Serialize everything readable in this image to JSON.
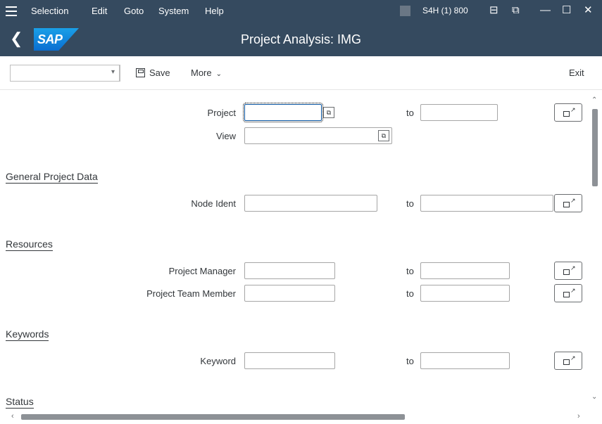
{
  "menubar": {
    "items": [
      "Selection",
      "Edit",
      "Goto",
      "System",
      "Help"
    ],
    "system_info": "S4H (1) 800",
    "icons": [
      "menu-icon",
      "system-status-icon",
      "layout-icon",
      "new-window-icon",
      "minimize-icon",
      "maximize-icon",
      "close-icon"
    ],
    "controls": {
      "layout": "⊟",
      "newwin": "⧉",
      "min": "—",
      "max": "☐",
      "close": "✕"
    }
  },
  "titlebar": {
    "logo_text": "SAP",
    "title": "Project Analysis: IMG",
    "back_glyph": "❮"
  },
  "toolbar": {
    "command_field_value": "",
    "save_label": "Save",
    "more_label": "More",
    "exit_label": "Exit"
  },
  "selection": {
    "to_label": "to",
    "project": {
      "label": "Project",
      "value_from": "",
      "value_to": ""
    },
    "view": {
      "label": "View",
      "value": ""
    }
  },
  "sections": {
    "general": {
      "title": "General Project Data",
      "fields": [
        {
          "label": "Node Ident",
          "value_from": "",
          "value_to": ""
        }
      ]
    },
    "resources": {
      "title": "Resources",
      "fields": [
        {
          "label": "Project Manager",
          "value_from": "",
          "value_to": ""
        },
        {
          "label": "Project Team Member",
          "value_from": "",
          "value_to": ""
        }
      ]
    },
    "keywords": {
      "title": "Keywords",
      "fields": [
        {
          "label": "Keyword",
          "value_from": "",
          "value_to": ""
        }
      ]
    },
    "status": {
      "title": "Status"
    }
  },
  "colors": {
    "shell": "#354a5f",
    "brand": "#0a6ed1",
    "text": "#32363a",
    "field_border": "#a6a6a6"
  }
}
